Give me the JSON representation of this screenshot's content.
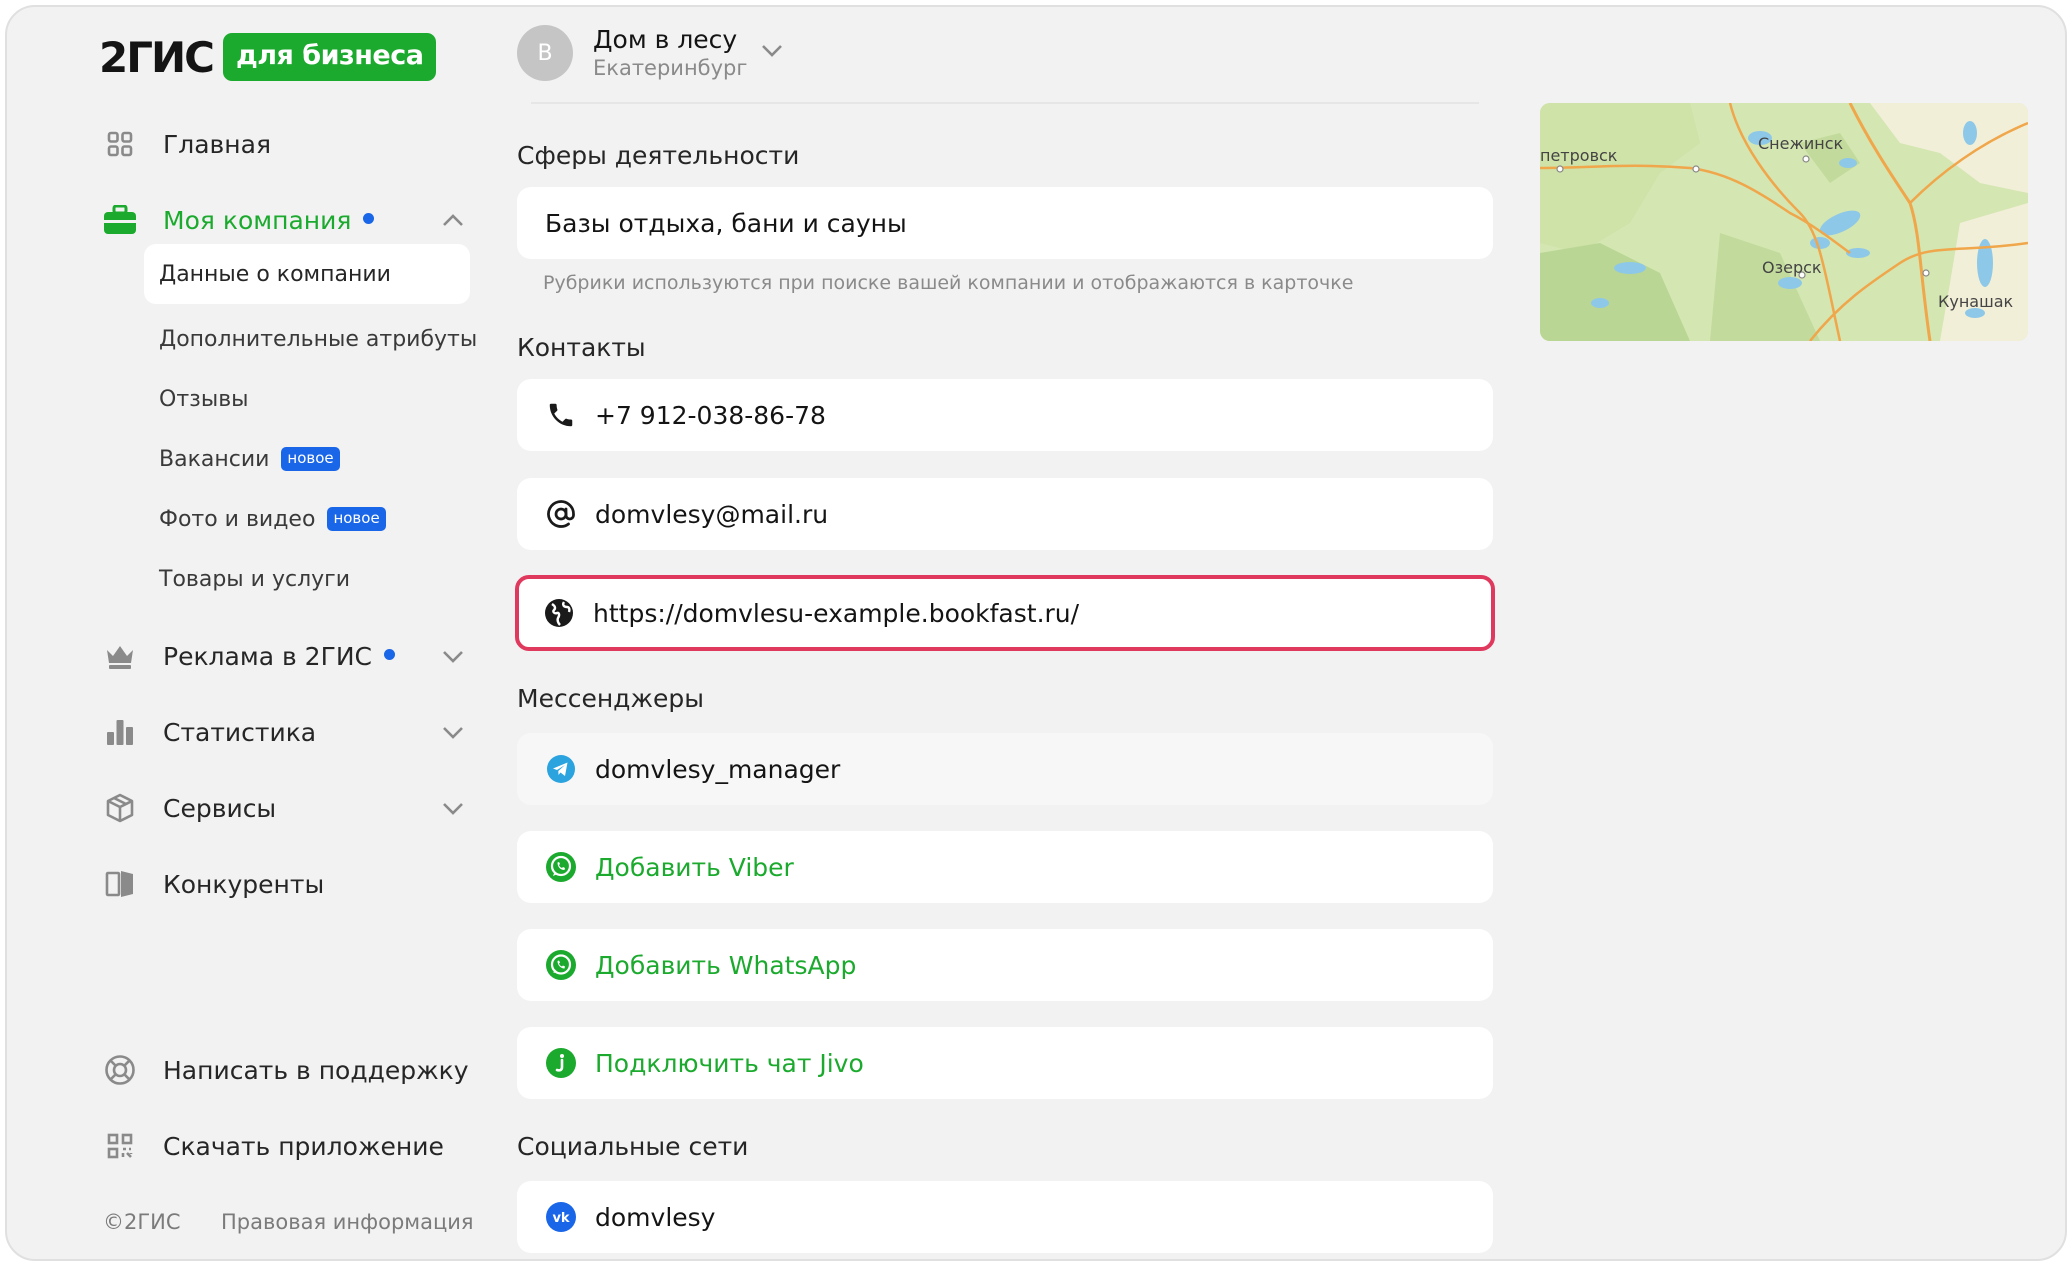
{
  "brand": {
    "name": "2ГИС",
    "badge": "для бизнеса"
  },
  "sidebar": {
    "items": [
      {
        "label": "Главная",
        "icon": "grid-icon"
      },
      {
        "label": "Моя компания",
        "icon": "briefcase-icon",
        "dot": true,
        "expanded": true
      },
      {
        "label": "Реклама в 2ГИС",
        "icon": "crown-icon",
        "dot": true
      },
      {
        "label": "Статистика",
        "icon": "bar-chart-icon"
      },
      {
        "label": "Сервисы",
        "icon": "box-icon"
      },
      {
        "label": "Конкуренты",
        "icon": "competitors-icon"
      }
    ],
    "subitems": [
      {
        "label": "Данные о компании",
        "active": true
      },
      {
        "label": "Дополнительные атрибуты"
      },
      {
        "label": "Отзывы"
      },
      {
        "label": "Вакансии",
        "badge": "новое"
      },
      {
        "label": "Фото и видео",
        "badge": "новое"
      },
      {
        "label": "Товары и услуги"
      }
    ],
    "bottom": [
      {
        "label": "Написать в поддержку",
        "icon": "lifebuoy-icon"
      },
      {
        "label": "Скачать приложение",
        "icon": "qr-code-icon"
      }
    ],
    "footer": {
      "copyright": "©2ГИС",
      "legal": "Правовая информация"
    }
  },
  "company": {
    "avatar_letter": "В",
    "name": "Дом в лесу",
    "city": "Екатеринбург"
  },
  "sections": {
    "activity": {
      "title": "Сферы деятельности",
      "value": "Базы отдыха, бани и сауны",
      "hint": "Рубрики используются при поиске вашей компании и отображаются в карточке"
    },
    "contacts": {
      "title": "Контакты",
      "phone": "+7 912-038-86-78",
      "email": "domvlesy@mail.ru",
      "website": "https://domvlesu-example.bookfast.ru/"
    },
    "messengers": {
      "title": "Мессенджеры",
      "telegram": "domvlesy_manager",
      "add_viber": "Добавить Viber",
      "add_whatsapp": "Добавить WhatsApp",
      "connect_jivo": "Подключить чат Jivo"
    },
    "social": {
      "title": "Социальные сети",
      "vk": "domvlesy"
    }
  },
  "map": {
    "labels": [
      "петровск",
      "Снежинск",
      "Озерск",
      "Кунашак"
    ]
  },
  "colors": {
    "accent": "#1baa2e",
    "blue": "#1a66e8",
    "highlight": "#e0395e",
    "background": "#f2f2f2"
  }
}
